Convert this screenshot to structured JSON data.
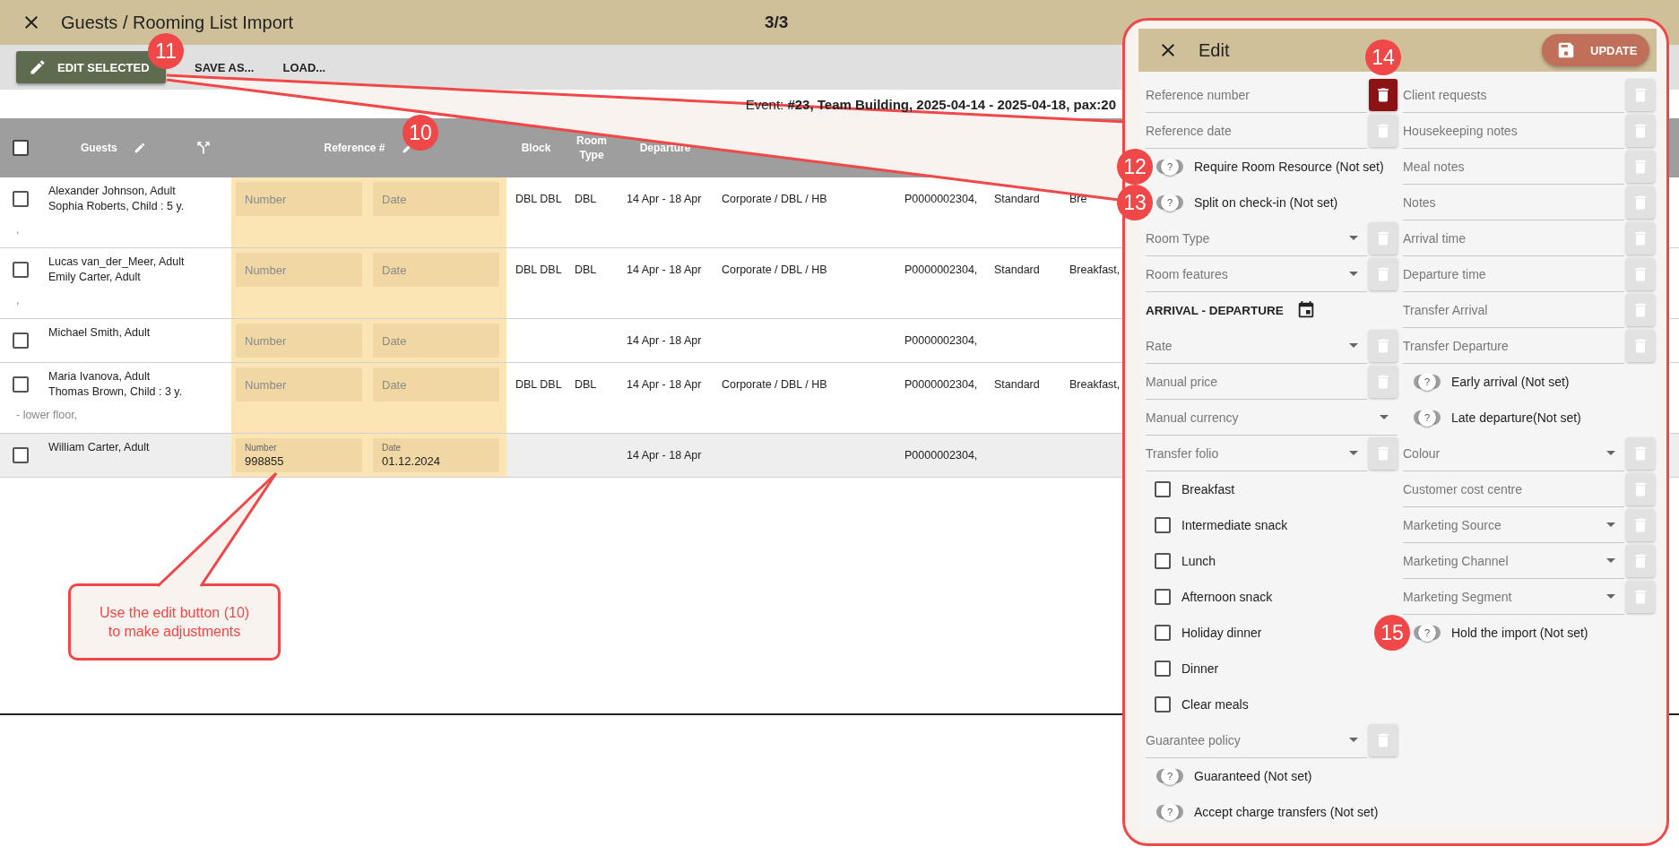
{
  "window": {
    "title": "Guests / Rooming List Import",
    "step": "3/3"
  },
  "toolbar": [
    {
      "label": "EDIT SELECTED",
      "kind": "primary",
      "badge": "11"
    },
    {
      "label": "SAVE AS...",
      "kind": "flat"
    },
    {
      "label": "LOAD...",
      "kind": "flat"
    }
  ],
  "event_info": "Event: **#23, Team Building, 2025-04-14 - 2025-04-18, pax:20**",
  "table": {
    "select_all_checked": false,
    "columns": [
      {
        "kind": "text",
        "label": "Guests",
        "editable": true
      },
      {
        "kind": "split"
      },
      {
        "kind": "text",
        "label": "Reference #",
        "editable": true,
        "badge": "10"
      },
      {
        "kind": "text",
        "label": "Block",
        "editable": false
      },
      {
        "kind": "text",
        "label": "Room Type",
        "editable": false
      },
      {
        "kind": "text",
        "label": "Departure",
        "editable": false
      }
    ],
    "rows": [
      {
        "checked": false,
        "highlighted": false,
        "guests": [
          "Alexander Johnson, Adult",
          "Sophia Roberts, Child : 5 y."
        ],
        "note": ",",
        "reference_number": {
          "placeholder": "Number"
        },
        "reference_date": {
          "placeholder": "Date"
        },
        "block": "DBL DBL",
        "room_type": "DBL",
        "dates": "14 Apr - 18 Apr",
        "rate": "Corporate / DBL / HB",
        "column_9": "P0000002304,",
        "column_10": "Standard",
        "column_11": "Bre"
      },
      {
        "checked": false,
        "highlighted": false,
        "guests": [
          "Lucas van_der_Meer, Adult",
          "Emily Carter, Adult"
        ],
        "note": ",",
        "reference_number": {
          "placeholder": "Number"
        },
        "reference_date": {
          "placeholder": "Date"
        },
        "block": "DBL DBL",
        "room_type": "DBL",
        "dates": "14 Apr - 18 Apr",
        "rate": "Corporate / DBL / HB",
        "column_9": "P0000002304,",
        "column_10": "Standard",
        "column_11": "Breakfast,"
      },
      {
        "checked": false,
        "highlighted": false,
        "guests": [
          "Michael Smith, Adult"
        ],
        "reference_number": {
          "placeholder": "Number"
        },
        "reference_date": {
          "placeholder": "Date"
        },
        "dates": "14 Apr - 18 Apr",
        "column_9": "P0000002304,"
      },
      {
        "checked": false,
        "highlighted": false,
        "guests": [
          "Maria Ivanova, Adult",
          "Thomas Brown, Child : 3 y."
        ],
        "note": "- lower floor,",
        "reference_number": {
          "placeholder": "Number"
        },
        "reference_date": {
          "placeholder": "Date"
        },
        "block": "DBL DBL",
        "room_type": "DBL",
        "dates": "14 Apr - 18 Apr",
        "rate": "Corporate / DBL / HB",
        "column_9": "P0000002304,",
        "column_10": "Standard",
        "column_11": "Breakfast,"
      },
      {
        "checked": false,
        "highlighted": true,
        "guests": [
          "William Carter, Adult"
        ],
        "reference_number": {
          "label": "Number",
          "value": "998855"
        },
        "reference_date": {
          "label": "Date",
          "value": "01.12.2024"
        },
        "dates": "14 Apr - 18 Apr",
        "column_9": "P0000002304,"
      }
    ]
  },
  "panel": {
    "title": "Edit",
    "update_label": "UPDATE",
    "columns": [
      [
        {
          "kind": "field",
          "label": "Reference number",
          "clearable": true,
          "trash_active": true,
          "badge": "14"
        },
        {
          "kind": "field",
          "label": "Reference date",
          "clearable": true,
          "trash_active": false
        },
        {
          "kind": "toggle",
          "label": "Require Room Resource (Not set)",
          "set": false,
          "knob": "?",
          "badge": "12"
        },
        {
          "kind": "toggle",
          "label": "Split on check-in (Not set)",
          "set": false,
          "knob": "?",
          "badge": "13"
        },
        {
          "kind": "select",
          "label": "Room Type",
          "clearable": true,
          "trash_active": false
        },
        {
          "kind": "select",
          "label": "Room features",
          "clearable": true,
          "trash_active": false
        },
        {
          "kind": "heading",
          "label": "ARRIVAL - DEPARTURE"
        },
        {
          "kind": "select",
          "label": "Rate",
          "clearable": true,
          "trash_active": false
        },
        {
          "kind": "field",
          "label": "Manual price",
          "clearable": true,
          "trash_active": false
        },
        {
          "kind": "select",
          "label": "Manual currency",
          "clearable": false
        },
        {
          "kind": "select",
          "label": "Transfer folio",
          "clearable": true,
          "trash_active": false
        },
        {
          "kind": "checkbox",
          "label": "Breakfast",
          "checked": false
        },
        {
          "kind": "checkbox",
          "label": "Intermediate snack",
          "checked": false
        },
        {
          "kind": "checkbox",
          "label": "Lunch",
          "checked": false
        },
        {
          "kind": "checkbox",
          "label": "Afternoon snack",
          "checked": false
        },
        {
          "kind": "checkbox",
          "label": "Holiday dinner",
          "checked": false
        },
        {
          "kind": "checkbox",
          "label": "Dinner",
          "checked": false
        },
        {
          "kind": "checkbox",
          "label": "Clear meals",
          "checked": false
        },
        {
          "kind": "select",
          "label": "Guarantee policy",
          "clearable": true,
          "trash_active": false
        },
        {
          "kind": "toggle",
          "label": "Guaranteed (Not set)",
          "set": false,
          "knob": "?"
        },
        {
          "kind": "toggle",
          "label": "Accept charge transfers (Not set)",
          "set": false,
          "knob": "?"
        }
      ],
      [
        {
          "kind": "field",
          "label": "Client requests",
          "clearable": true,
          "trash_active": false
        },
        {
          "kind": "field",
          "label": "Housekeeping notes",
          "clearable": true,
          "trash_active": false
        },
        {
          "kind": "field",
          "label": "Meal notes",
          "clearable": true,
          "trash_active": false
        },
        {
          "kind": "field",
          "label": "Notes",
          "clearable": true,
          "trash_active": false
        },
        {
          "kind": "field",
          "label": "Arrival time",
          "clearable": true,
          "trash_active": false
        },
        {
          "kind": "field",
          "label": "Departure time",
          "clearable": true,
          "trash_active": false
        },
        {
          "kind": "field",
          "label": "Transfer Arrival",
          "clearable": true,
          "trash_active": false
        },
        {
          "kind": "field",
          "label": "Transfer Departure",
          "clearable": true,
          "trash_active": false
        },
        {
          "kind": "toggle",
          "label": "Early arrival (Not set)",
          "set": false,
          "knob": "?"
        },
        {
          "kind": "toggle",
          "label": "Late departure(Not set)",
          "set": false,
          "knob": "?"
        },
        {
          "kind": "select",
          "label": "Colour",
          "clearable": true,
          "trash_active": false
        },
        {
          "kind": "field",
          "label": "Customer cost centre",
          "clearable": true,
          "trash_active": false
        },
        {
          "kind": "select",
          "label": "Marketing Source",
          "clearable": true,
          "trash_active": false
        },
        {
          "kind": "select",
          "label": "Marketing Channel",
          "clearable": true,
          "trash_active": false
        },
        {
          "kind": "select",
          "label": "Marketing Segment",
          "clearable": true,
          "trash_active": false
        },
        {
          "kind": "toggle",
          "label": "Hold the import (Not set)",
          "set": false,
          "knob": "?",
          "badge": "15"
        }
      ]
    ]
  },
  "annotation": {
    "text": "Use the edit button (10) to make adjustments"
  }
}
